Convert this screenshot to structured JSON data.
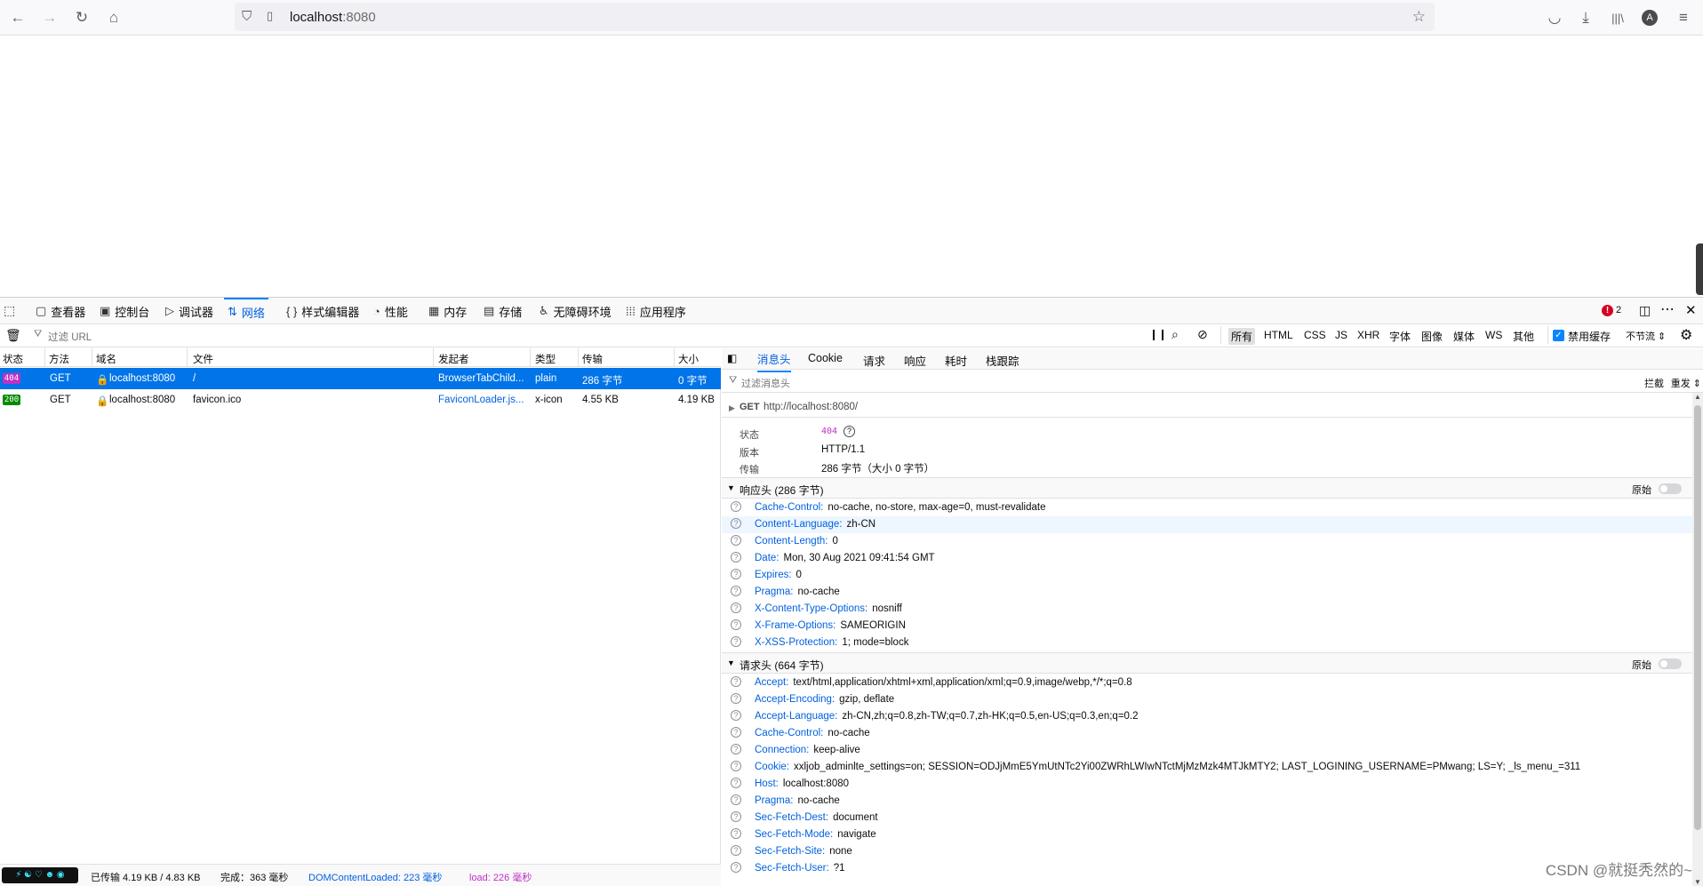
{
  "browser": {
    "url_host": "localhost",
    "url_port": ":8080",
    "account_initial": "A"
  },
  "devtools": {
    "tabs": [
      {
        "label": "查看器",
        "icon": "inspector-icon"
      },
      {
        "label": "控制台",
        "icon": "console-icon"
      },
      {
        "label": "调试器",
        "icon": "debugger-icon"
      },
      {
        "label": "网络",
        "icon": "network-icon"
      },
      {
        "label": "样式编辑器",
        "icon": "style-editor-icon"
      },
      {
        "label": "性能",
        "icon": "performance-icon"
      },
      {
        "label": "内存",
        "icon": "memory-icon"
      },
      {
        "label": "存储",
        "icon": "storage-icon"
      },
      {
        "label": "无障碍环境",
        "icon": "accessibility-icon"
      },
      {
        "label": "应用程序",
        "icon": "application-icon"
      }
    ],
    "error_count": "2",
    "filter_placeholder": "过滤 URL",
    "type_filters": [
      "所有",
      "HTML",
      "CSS",
      "JS",
      "XHR",
      "字体",
      "图像",
      "媒体",
      "WS",
      "其他"
    ],
    "disable_cache_label": "禁用缓存",
    "throttle_label": "不节流 ⇕"
  },
  "request_list": {
    "columns": [
      "状态",
      "方法",
      "域名",
      "文件",
      "发起者",
      "类型",
      "传输",
      "大小"
    ],
    "rows": [
      {
        "status": "404",
        "method": "GET",
        "domain": "localhost:8080",
        "file": "/",
        "initiator": "BrowserTabChild...",
        "type": "plain",
        "transfer": "286 字节",
        "size": "0 字节"
      },
      {
        "status": "200",
        "method": "GET",
        "domain": "localhost:8080",
        "file": "favicon.ico",
        "initiator": "FaviconLoader.js...",
        "type": "x-icon",
        "transfer": "4.55 KB",
        "size": "4.19 KB"
      }
    ],
    "status_colors": {
      "404": "#d70022",
      "200": "#058b00"
    }
  },
  "statusbar": {
    "transferred": "已传输 4.19 KB / 4.83 KB",
    "finish": "完成：363 毫秒",
    "dom_loaded": "DOMContentLoaded: 223 毫秒",
    "load": "load: 226 毫秒"
  },
  "details": {
    "tabs": [
      "消息头",
      "Cookie",
      "请求",
      "响应",
      "耗时",
      "栈跟踪"
    ],
    "filter_placeholder": "过滤消息头",
    "block_label": "拦截",
    "resend_label": "重发 ⇕",
    "request_line": {
      "method": "GET",
      "url": "http://localhost:8080/"
    },
    "summary": {
      "status_label": "状态",
      "status_value": "404",
      "version_label": "版本",
      "version_value": "HTTP/1.1",
      "transfer_label": "传输",
      "transfer_value": "286 字节（大小 0 字节）"
    },
    "raw_label": "原始",
    "response_title": "响应头 (286 字节)",
    "response_headers": [
      {
        "name": "Cache-Control:",
        "value": "no-cache, no-store, max-age=0, must-revalidate"
      },
      {
        "name": "Content-Language:",
        "value": "zh-CN"
      },
      {
        "name": "Content-Length:",
        "value": "0"
      },
      {
        "name": "Date:",
        "value": "Mon, 30 Aug 2021 09:41:54 GMT"
      },
      {
        "name": "Expires:",
        "value": "0"
      },
      {
        "name": "Pragma:",
        "value": "no-cache"
      },
      {
        "name": "X-Content-Type-Options:",
        "value": "nosniff"
      },
      {
        "name": "X-Frame-Options:",
        "value": "SAMEORIGIN"
      },
      {
        "name": "X-XSS-Protection:",
        "value": "1; mode=block"
      }
    ],
    "request_title": "请求头 (664 字节)",
    "request_headers": [
      {
        "name": "Accept:",
        "value": "text/html,application/xhtml+xml,application/xml;q=0.9,image/webp,*/*;q=0.8"
      },
      {
        "name": "Accept-Encoding:",
        "value": "gzip, deflate"
      },
      {
        "name": "Accept-Language:",
        "value": "zh-CN,zh;q=0.8,zh-TW;q=0.7,zh-HK;q=0.5,en-US;q=0.3,en;q=0.2"
      },
      {
        "name": "Cache-Control:",
        "value": "no-cache"
      },
      {
        "name": "Connection:",
        "value": "keep-alive"
      },
      {
        "name": "Cookie:",
        "value": "xxljob_adminlte_settings=on; SESSION=ODJjMmE5YmUtNTc2Yi00ZWRhLWIwNTctMjMzMzk4MTJkMTY2; LAST_LOGINING_USERNAME=PMwang; LS=Y; _ls_menu_=311"
      },
      {
        "name": "Host:",
        "value": "localhost:8080"
      },
      {
        "name": "Pragma:",
        "value": "no-cache"
      },
      {
        "name": "Sec-Fetch-Dest:",
        "value": "document"
      },
      {
        "name": "Sec-Fetch-Mode:",
        "value": "navigate"
      },
      {
        "name": "Sec-Fetch-Site:",
        "value": "none"
      },
      {
        "name": "Sec-Fetch-User:",
        "value": "?1"
      }
    ]
  },
  "watermark": "CSDN @就挺秃然的~"
}
